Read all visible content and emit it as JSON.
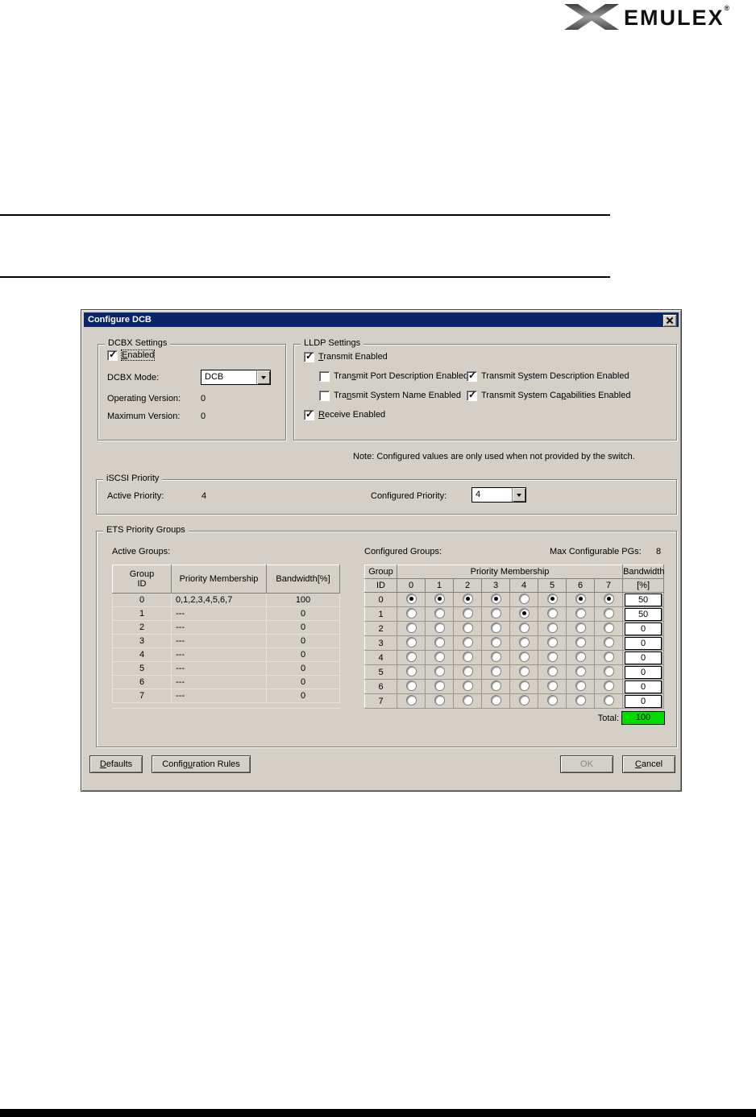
{
  "brand": {
    "name": "EMULEX",
    "registered": "®",
    "icon": "emulex-x-swoosh"
  },
  "colors": {
    "title_bar": "#0a246a",
    "title_text": "#ffffff",
    "dialog_bg": "#d4d0c8",
    "total_bg": "#00dc00",
    "rule": "#000000"
  },
  "dialog": {
    "title": "Configure DCB",
    "dcbx": {
      "label": "DCBX Settings",
      "enabled": {
        "text": "Enabled",
        "m": 0,
        "checked": true
      },
      "mode_label": "DCBX Mode:",
      "mode_value": "DCB",
      "operating_label": "Operating Version:",
      "operating_value": "0",
      "maximum_label": "Maximum Version:",
      "maximum_value": "0"
    },
    "lldp": {
      "label": "LLDP Settings",
      "transmit": {
        "text": "Transmit Enabled",
        "m": 0,
        "checked": true
      },
      "port_desc": {
        "text": "Transmit Port Description Enabled",
        "m": 4,
        "checked": false
      },
      "sys_desc": {
        "text": "Transmit System Description Enabled",
        "m": 10,
        "checked": true
      },
      "sys_name": {
        "text": "Transmit System Name Enabled",
        "m": 3,
        "checked": false
      },
      "sys_cap": {
        "text": "Transmit System Capabilities Enabled",
        "m": 18,
        "checked": true
      },
      "receive": {
        "text": "Receive Enabled",
        "m": 0,
        "checked": true
      }
    },
    "note": "Note: Configured values are only used when not provided by the switch.",
    "iscsi": {
      "label": "iSCSI Priority",
      "active_label": "Active Priority:",
      "active_value": "4",
      "configured_label": "Configured Priority:",
      "configured_value": "4"
    },
    "ets": {
      "label": "ETS Priority Groups",
      "active": {
        "label": "Active Groups:",
        "headers": [
          "Group\nID",
          "Priority Membership",
          "Bandwidth[%]"
        ],
        "rows": [
          {
            "id": "0",
            "membership": "0,1,2,3,4,5,6,7",
            "bandwidth": "100"
          },
          {
            "id": "1",
            "membership": "---",
            "bandwidth": "0"
          },
          {
            "id": "2",
            "membership": "---",
            "bandwidth": "0"
          },
          {
            "id": "3",
            "membership": "---",
            "bandwidth": "0"
          },
          {
            "id": "4",
            "membership": "---",
            "bandwidth": "0"
          },
          {
            "id": "5",
            "membership": "---",
            "bandwidth": "0"
          },
          {
            "id": "6",
            "membership": "---",
            "bandwidth": "0"
          },
          {
            "id": "7",
            "membership": "---",
            "bandwidth": "0"
          }
        ]
      },
      "configured": {
        "label": "Configured Groups:",
        "max_label": "Max Configurable PGs:",
        "max_value": "8",
        "header": {
          "group": "Group",
          "id": "ID",
          "membership": "Priority Membership",
          "priorities": [
            "0",
            "1",
            "2",
            "3",
            "4",
            "5",
            "6",
            "7"
          ],
          "bandwidth": "Bandwidth",
          "pct": "[%]"
        },
        "rows": [
          {
            "id": "0",
            "selected": [
              true,
              true,
              true,
              true,
              false,
              true,
              true,
              true
            ],
            "bandwidth": "50"
          },
          {
            "id": "1",
            "selected": [
              false,
              false,
              false,
              false,
              true,
              false,
              false,
              false
            ],
            "bandwidth": "50"
          },
          {
            "id": "2",
            "selected": [
              false,
              false,
              false,
              false,
              false,
              false,
              false,
              false
            ],
            "bandwidth": "0"
          },
          {
            "id": "3",
            "selected": [
              false,
              false,
              false,
              false,
              false,
              false,
              false,
              false
            ],
            "bandwidth": "0"
          },
          {
            "id": "4",
            "selected": [
              false,
              false,
              false,
              false,
              false,
              false,
              false,
              false
            ],
            "bandwidth": "0"
          },
          {
            "id": "5",
            "selected": [
              false,
              false,
              false,
              false,
              false,
              false,
              false,
              false
            ],
            "bandwidth": "0"
          },
          {
            "id": "6",
            "selected": [
              false,
              false,
              false,
              false,
              false,
              false,
              false,
              false
            ],
            "bandwidth": "0"
          },
          {
            "id": "7",
            "selected": [
              false,
              false,
              false,
              false,
              false,
              false,
              false,
              false
            ],
            "bandwidth": "0"
          }
        ],
        "total_label": "Total:",
        "total_value": "100"
      }
    },
    "buttons": {
      "defaults": {
        "text": "Defaults",
        "m": 0
      },
      "config_rules": {
        "text": "Configuration Rules",
        "m": 6
      },
      "ok": {
        "text": "OK",
        "disabled": true
      },
      "cancel": {
        "text": "Cancel",
        "m": 0
      }
    }
  }
}
